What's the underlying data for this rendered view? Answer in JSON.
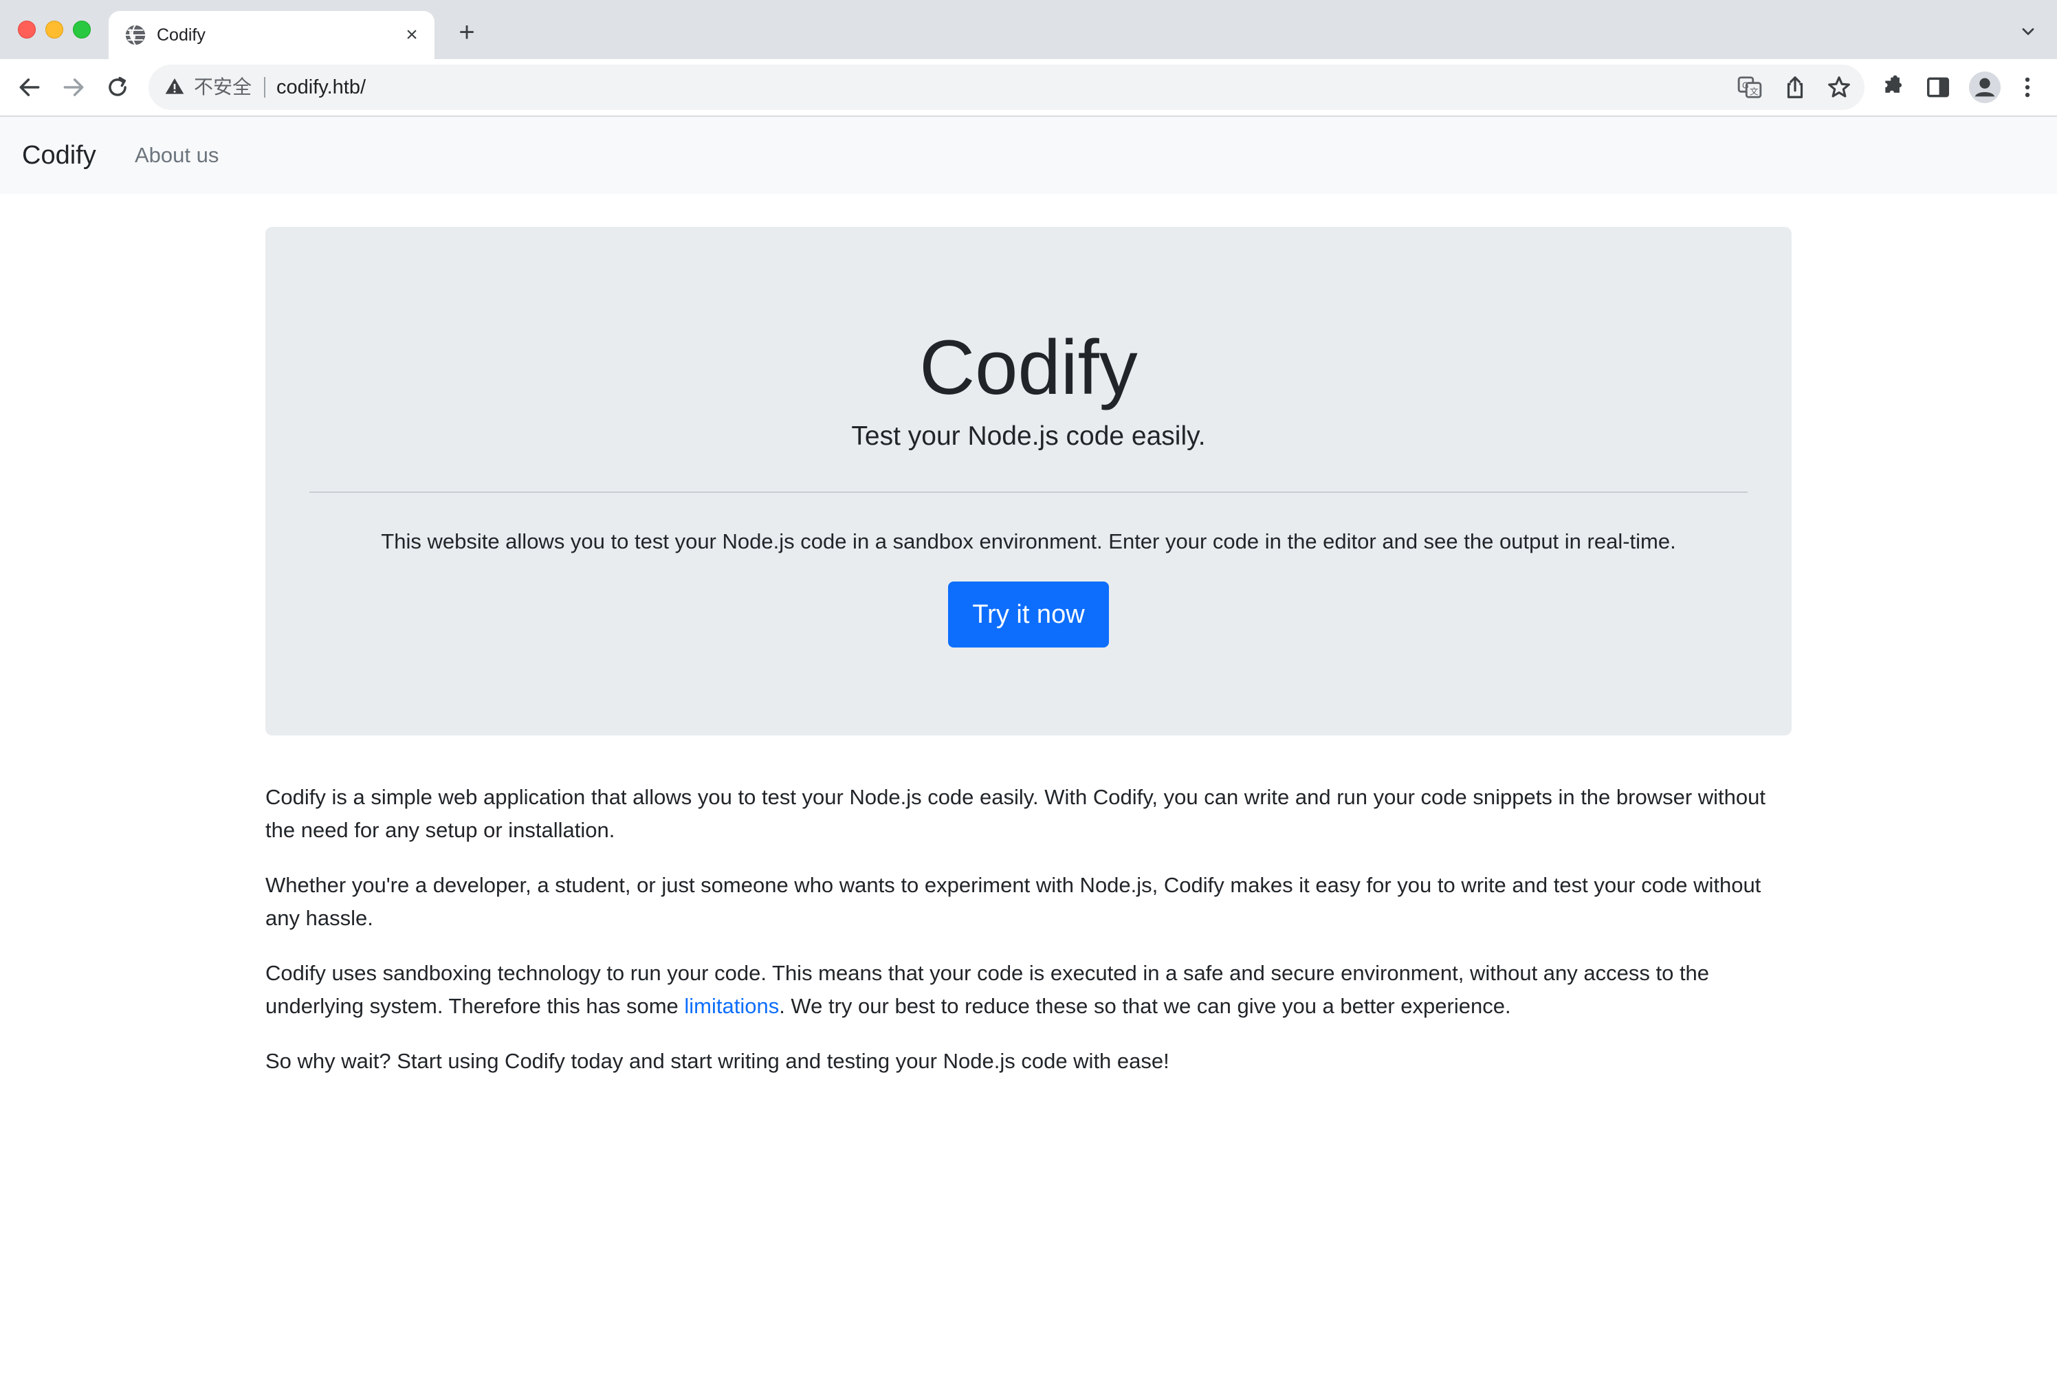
{
  "browser": {
    "tab_title": "Codify",
    "tab_close": "×",
    "new_tab": "+",
    "security_label": "不安全",
    "url": "codify.htb/"
  },
  "navbar": {
    "brand": "Codify",
    "link_about": "About us"
  },
  "hero": {
    "title": "Codify",
    "lead": "Test your Node.js code easily.",
    "text": "This website allows you to test your Node.js code in a sandbox environment. Enter your code in the editor and see the output in real-time.",
    "button": "Try it now"
  },
  "content": {
    "p1": "Codify is a simple web application that allows you to test your Node.js code easily. With Codify, you can write and run your code snippets in the browser without the need for any setup or installation.",
    "p2": "Whether you're a developer, a student, or just someone who wants to experiment with Node.js, Codify makes it easy for you to write and test your code without any hassle.",
    "p3_before": "Codify uses sandboxing technology to run your code. This means that your code is executed in a safe and secure environment, without any access to the underlying system. Therefore this has some ",
    "p3_link": "limitations",
    "p3_after": ". We try our best to reduce these so that we can give you a better experience.",
    "p4": "So why wait? Start using Codify today and start writing and testing your Node.js code with ease!"
  },
  "colors": {
    "primary": "#0d6efd",
    "navbar_bg": "#f8f9fa",
    "jumbotron_bg": "#e9ecef",
    "text": "#212529",
    "muted": "#6c757d"
  },
  "icons": [
    "globe-icon",
    "close-icon",
    "plus-icon",
    "chevron-down-icon",
    "back-arrow-icon",
    "forward-arrow-icon",
    "reload-icon",
    "warning-icon",
    "translate-icon",
    "share-icon",
    "star-icon",
    "extensions-icon",
    "side-panel-icon",
    "profile-icon",
    "more-vert-icon"
  ]
}
